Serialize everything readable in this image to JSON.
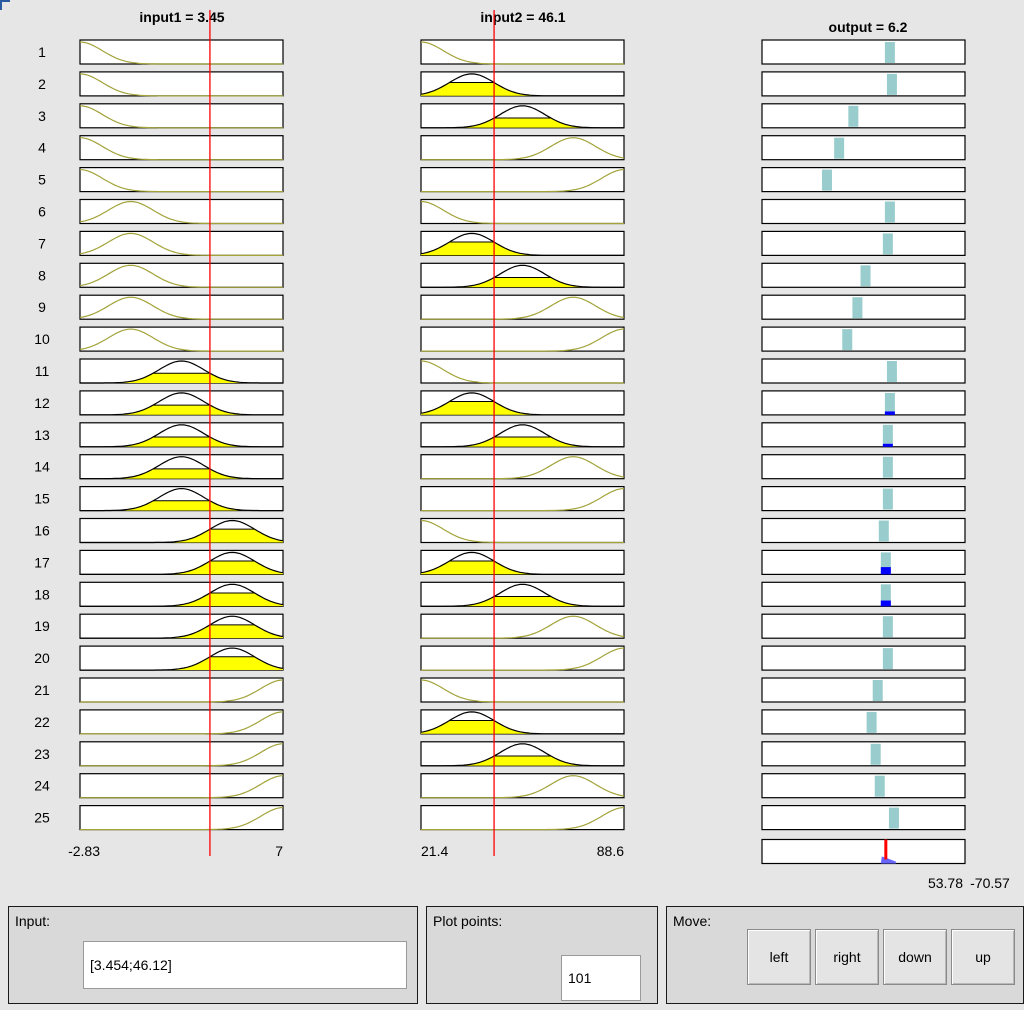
{
  "columns": [
    {
      "title": "input1 = 3.45",
      "min_label": "-2.83",
      "max_label": "7"
    },
    {
      "title": "input2 = 46.1",
      "min_label": "21.4",
      "max_label": "88.6"
    },
    {
      "title": "output = 6.2",
      "min_label": "-70.57",
      "max_label": "53.78"
    }
  ],
  "rows": [
    "1",
    "2",
    "3",
    "4",
    "5",
    "6",
    "7",
    "8",
    "9",
    "10",
    "11",
    "12",
    "13",
    "14",
    "15",
    "16",
    "17",
    "18",
    "19",
    "20",
    "21",
    "22",
    "23",
    "24",
    "25"
  ],
  "input1_mf": [
    0,
    0,
    0,
    0,
    0,
    1,
    1,
    1,
    1,
    1,
    2,
    2,
    2,
    2,
    2,
    3,
    3,
    3,
    3,
    3,
    4,
    4,
    4,
    4,
    4
  ],
  "input2_mf": [
    0,
    1,
    2,
    3,
    4,
    0,
    1,
    2,
    3,
    4,
    0,
    1,
    2,
    3,
    4,
    0,
    1,
    2,
    3,
    4,
    0,
    1,
    2,
    3,
    4
  ],
  "output_positions": [
    0.63,
    0.64,
    0.45,
    0.38,
    0.32,
    0.63,
    0.62,
    0.51,
    0.47,
    0.42,
    0.64,
    0.63,
    0.62,
    0.62,
    0.62,
    0.6,
    0.61,
    0.61,
    0.62,
    0.62,
    0.57,
    0.54,
    0.56,
    0.58,
    0.65
  ],
  "output_fire": [
    0,
    0,
    0,
    0,
    0,
    0,
    0,
    0,
    0,
    0,
    0,
    0.18,
    0.12,
    0,
    0,
    0,
    0.38,
    0.3,
    0,
    0,
    0,
    0,
    0,
    0,
    0
  ],
  "input1_marker": 0.64,
  "input2_marker": 0.36,
  "output_marker": 0.61,
  "colors": {
    "mf_curve": "#a3a33a",
    "fill": "#ffff00",
    "marker": "#ff0000",
    "output_bar": "#99cccc",
    "output_fire": "#0000ff"
  },
  "controls": {
    "input_label": "Input:",
    "input_value": "[3.454;46.12]",
    "plot_points_label": "Plot points:",
    "plot_points_value": "101",
    "move_label": "Move:",
    "buttons": [
      "left",
      "right",
      "down",
      "up"
    ]
  }
}
